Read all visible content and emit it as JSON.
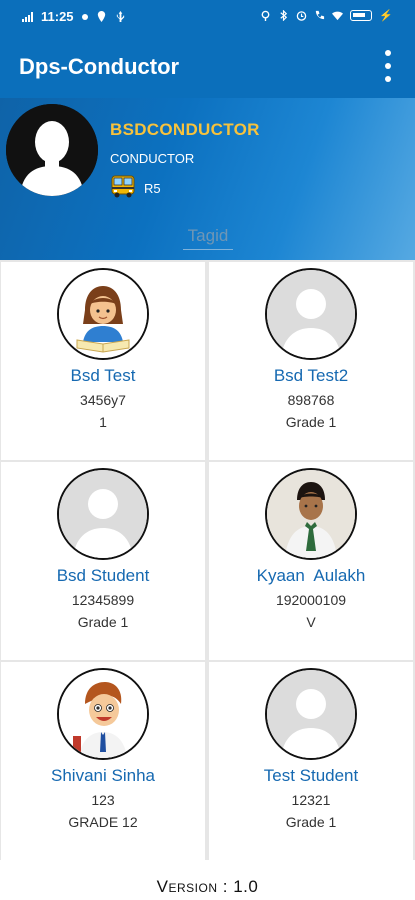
{
  "status_bar": {
    "time": "11:25",
    "icons_left": [
      "signal-icon",
      "dot-icon",
      "location-pin-icon",
      "usb-icon"
    ],
    "icons_right": [
      "location-icon",
      "bluetooth-icon",
      "alarm-icon",
      "call-icon",
      "wifi-icon",
      "battery-icon"
    ],
    "battery_level": "88",
    "charging": true
  },
  "app_bar": {
    "title": "Dps-Conductor",
    "menu_icon": "more-vertical-icon"
  },
  "profile": {
    "name": "BSDCONDUCTOR",
    "role": "CONDUCTOR",
    "route": "R5",
    "avatar_icon": "person-avatar-icon",
    "bus_icon": "school-bus-icon",
    "tag_placeholder": "Tagid"
  },
  "students": [
    {
      "name": "Bsd Test",
      "id": "3456y7",
      "grade": "1",
      "avatar": "girl-reading-avatar"
    },
    {
      "name": "Bsd Test2",
      "id": "898768",
      "grade": "Grade 1",
      "avatar": "placeholder-avatar"
    },
    {
      "name": "Bsd Student",
      "id": "12345899",
      "grade": "Grade 1",
      "avatar": "placeholder-avatar"
    },
    {
      "name": "Kyaan  Aulakh",
      "id": "192000109",
      "grade": "V",
      "avatar": "boy-photo-avatar"
    },
    {
      "name": "Shivani Sinha",
      "id": "123",
      "grade": "GRADE 12",
      "avatar": "cartoon-boy-avatar"
    },
    {
      "name": "Test Student",
      "id": "12321",
      "grade": "Grade 1",
      "avatar": "placeholder-avatar"
    }
  ],
  "footer": {
    "version": "Version : 1.0"
  },
  "colors": {
    "app_bar": "#0b6fbb",
    "name_accent": "#f6c23d",
    "student_name": "#1669b1"
  }
}
